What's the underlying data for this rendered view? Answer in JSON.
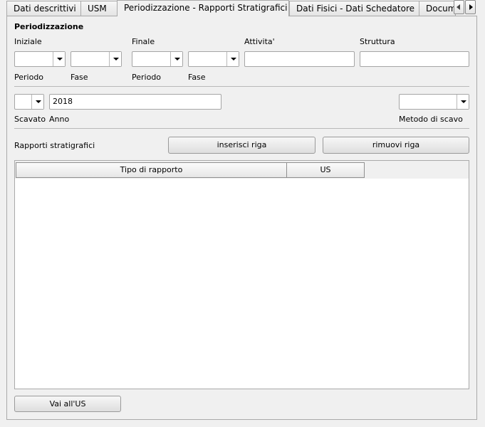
{
  "tabs": [
    {
      "label": "Dati descrittivi"
    },
    {
      "label": "USM"
    },
    {
      "label": "Periodizzazione - Rapporti Stratigrafici"
    },
    {
      "label": "Dati Fisici - Dati Schedatore"
    },
    {
      "label": "Docum"
    }
  ],
  "section_title": "Periodizzazione",
  "periodizzazione": {
    "iniziale_label": "Iniziale",
    "finale_label": "Finale",
    "attivita_label": "Attivita'",
    "struttura_label": "Struttura",
    "periodo_label": "Periodo",
    "fase_label": "Fase",
    "attivita_value": "",
    "struttura_value": ""
  },
  "scavo": {
    "scavato_label": "Scavato",
    "anno_label": "Anno",
    "anno_value": "2018",
    "metodo_label": "Metodo di scavo"
  },
  "rapporti": {
    "label": "Rapporti stratigrafici",
    "insert_button": "inserisci riga",
    "remove_button": "rimuovi riga",
    "columns": [
      "Tipo di rapporto",
      "US"
    ],
    "rows": []
  },
  "goto_button": "Vai all'US",
  "icons": {
    "dropdown": "chevron-down-icon",
    "scroll_left": "arrow-left-icon",
    "scroll_right": "arrow-right-icon"
  }
}
